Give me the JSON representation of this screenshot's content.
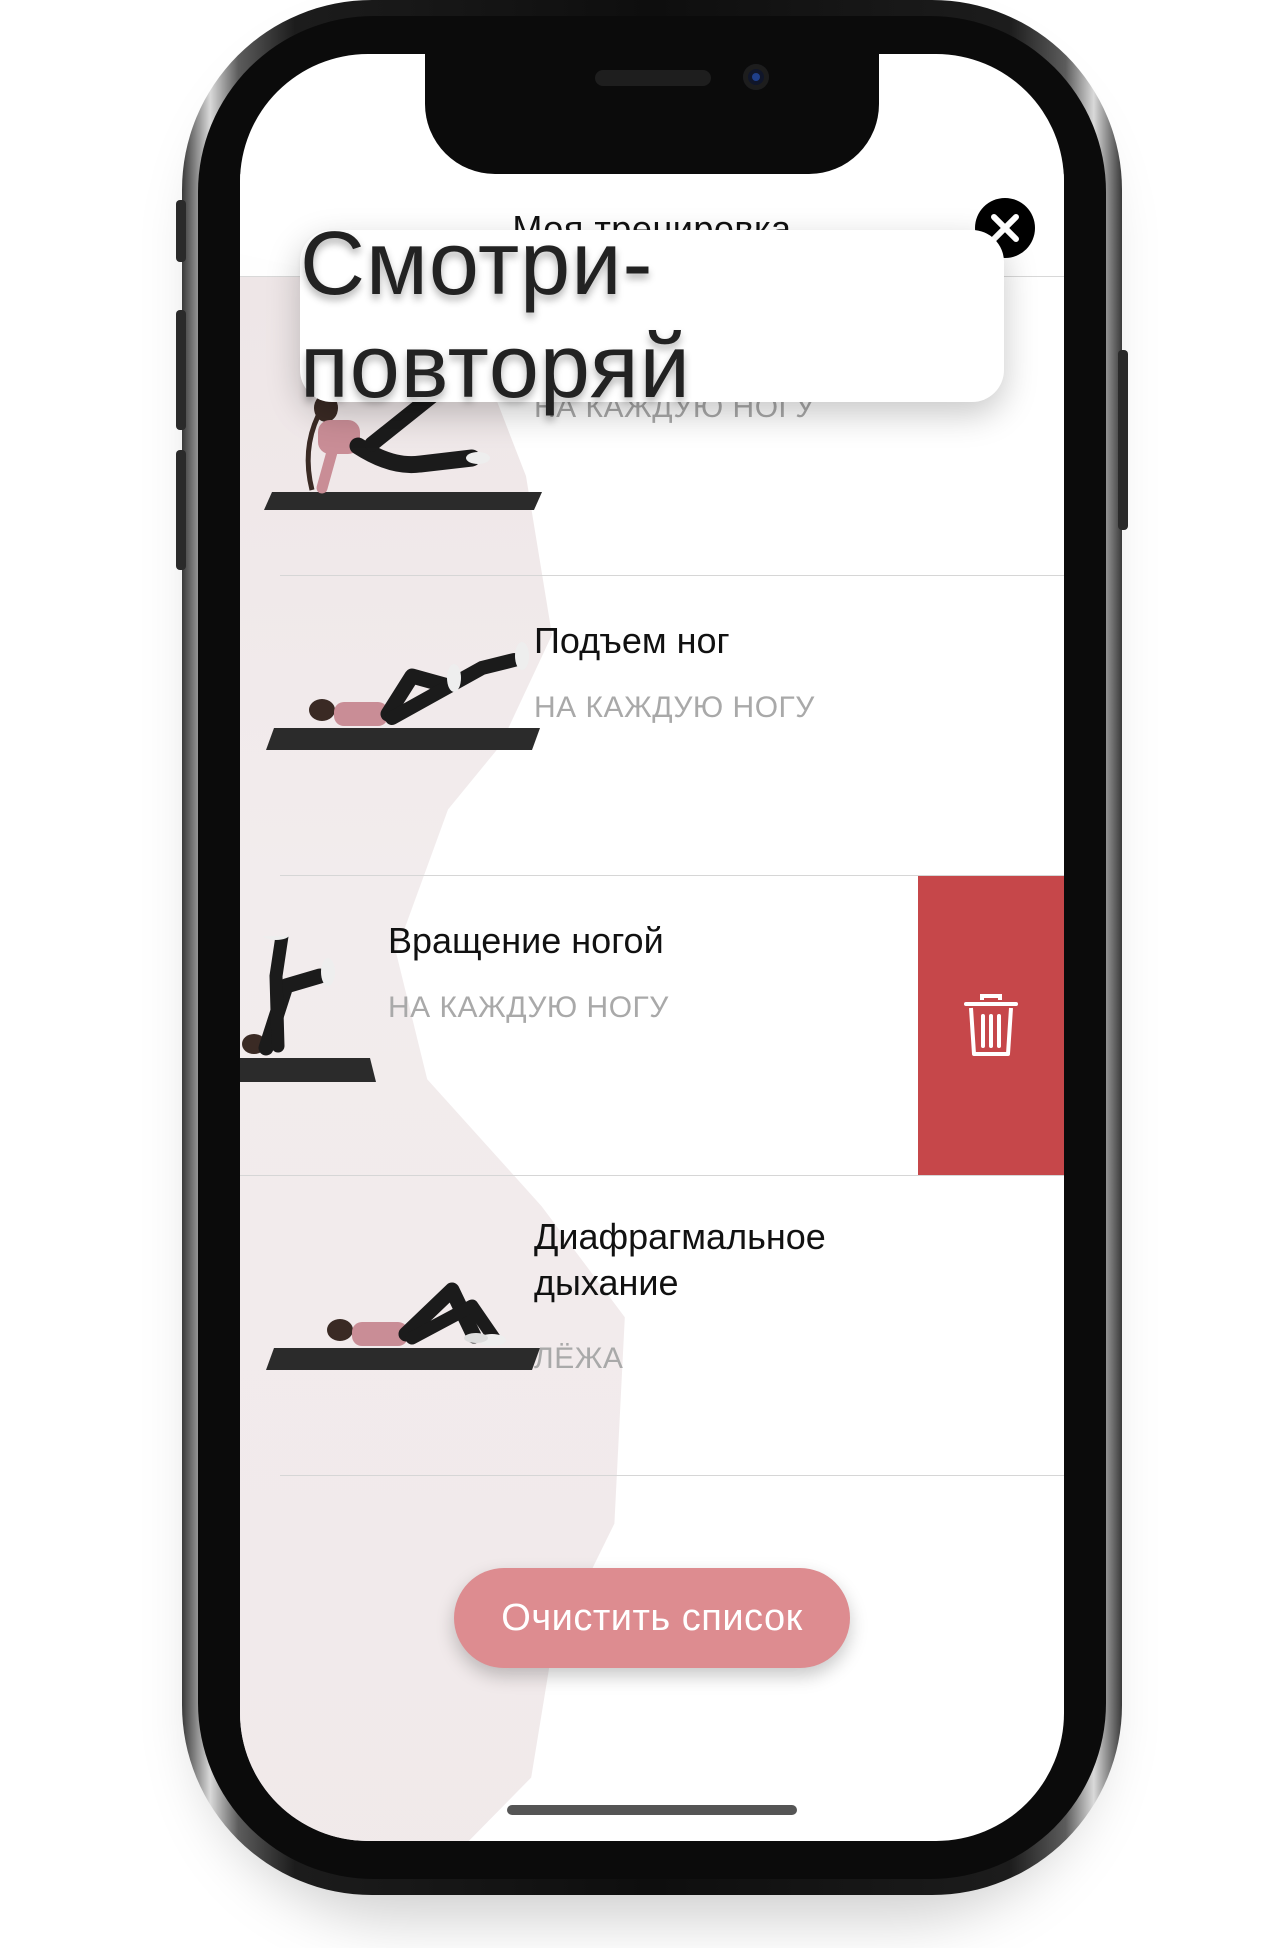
{
  "header": {
    "title": "Моя тренировка"
  },
  "banner": {
    "text": "Смотри-повторяй"
  },
  "exercises": [
    {
      "title": "",
      "subtitle": "НА КАЖДУЮ НОГУ"
    },
    {
      "title": "Подъем ног",
      "subtitle": "НА КАЖДУЮ НОГУ"
    },
    {
      "title": "Вращение ногой",
      "subtitle": "НА КАЖДУЮ НОГУ",
      "swiped": true
    },
    {
      "title": "Диафрагмальное дыхание",
      "subtitle": "ЛЁЖА"
    }
  ],
  "actions": {
    "clear_list": "Очистить список"
  },
  "icons": {
    "close": "close-icon",
    "delete": "trash-icon"
  },
  "colors": {
    "delete_bg": "#c6474a",
    "button_bg": "#dd8c90",
    "outfit_pink": "#c98d96",
    "mat": "#2b2b2b"
  }
}
